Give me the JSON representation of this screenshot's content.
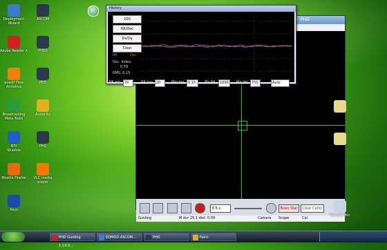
{
  "desktop": {
    "icons_left": [
      {
        "name": "dicon-deployment-wizard",
        "label": "Deployment\nWizard",
        "color": "#3a7ad0"
      },
      {
        "name": "dicon-adobe-reader",
        "label": "Adobe Reader X",
        "color": "#d02020"
      },
      {
        "name": "dicon-avast",
        "label": "avast! Free\nAntivirus",
        "color": "#f08010"
      },
      {
        "name": "dicon-broadcasting",
        "label": "Broadcasting\nMeta Tools",
        "color": "#2a9a3a"
      },
      {
        "name": "dicon-nti",
        "label": "NTI\nShadow",
        "color": "#2060c0"
      },
      {
        "name": "dicon-firefox",
        "label": "Mozilla Firefox",
        "color": "#e86a10"
      },
      {
        "name": "dicon-asus",
        "label": "Asus",
        "color": "#1a4ab0"
      }
    ],
    "icons_col2": [
      {
        "name": "dicon-1",
        "label": "ASCOM",
        "color": "#2a3a4a"
      },
      {
        "name": "dicon-2",
        "label": "PHD2",
        "color": "#2a3a4a"
      },
      {
        "name": "dicon-3",
        "label": "PHD",
        "color": "#2a3a4a"
      },
      {
        "name": "dicon-audacity",
        "label": "Audacity",
        "color": "#e0b020"
      },
      {
        "name": "dicon-5",
        "label": "PHD",
        "color": "#2a3a4a"
      },
      {
        "name": "dicon-vlc",
        "label": "VLC media player",
        "color": "#f07a00"
      }
    ],
    "icons_right": [
      {
        "name": "dicon-folder-1",
        "label": "",
        "color": "#e8d890"
      },
      {
        "name": "dicon-folder-2",
        "label": "",
        "color": "#e8d890"
      },
      {
        "name": "dicon-recycle-bin",
        "label": "Recycle Bin",
        "color": "#c8d4e0"
      }
    ]
  },
  "history": {
    "title": "History",
    "buttons": [
      "100",
      "RA/Dec",
      "Dx/Dy",
      "Clear"
    ],
    "legend": {
      "ra": "RA",
      "dec": "Dec"
    },
    "osc_label": "Osc. Index",
    "osc_value": "0.59",
    "rms_label": "RMS: 0.15",
    "controls": [
      {
        "label": "RA agr",
        "value": "70"
      },
      {
        "label": "RA hys",
        "value": "20"
      },
      {
        "label": "Min mo",
        "value": "0.15"
      },
      {
        "label": "Mx RA",
        "value": "1000"
      },
      {
        "label": "Mx dec",
        "value": "750"
      },
      {
        "label": "",
        "value": "Auto"
      }
    ],
    "ra_color": "#3a6aff",
    "dec_color": "#ff3a3a"
  },
  "phd": {
    "title": "PHD",
    "toolbar": {
      "exposure": "0.5 s",
      "star_btn": "Brain Star",
      "cal_btn": "Clear Calibr"
    },
    "status": {
      "state": "Guiding",
      "mass": "M dur 25.1 dist: 0.09",
      "camera": "Camera",
      "scope": "Scope",
      "cal": "Cal"
    },
    "crosshair_color": "#1ec41e"
  },
  "taskbar": {
    "items": [
      {
        "label": "PHD Guiding 1.13.0...",
        "color": "#d02020"
      },
      {
        "label": "EQMOD ASCOM...",
        "color": "#3a7ad0"
      },
      {
        "label": "PHD",
        "color": "#2a3a4a"
      },
      {
        "label": "Paint",
        "color": "#e0b020"
      }
    ]
  }
}
